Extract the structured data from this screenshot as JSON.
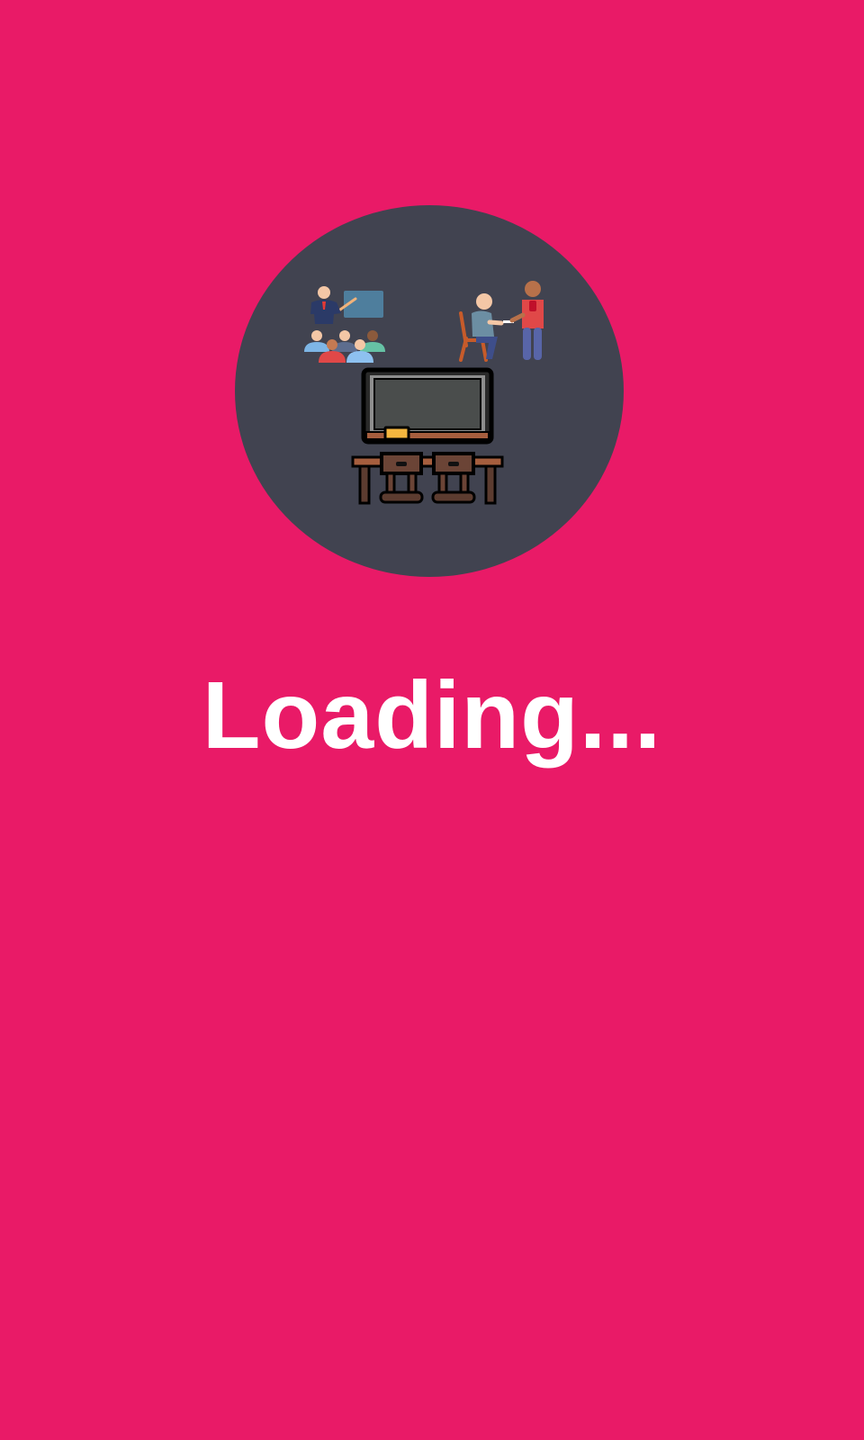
{
  "splash": {
    "loading_text": "Loading...",
    "background_color": "#E91A67",
    "logo_background_color": "#414350",
    "logo_icons": [
      "teacher-presenting-icon",
      "tutor-and-student-icon",
      "chalkboard-desk-icon"
    ]
  }
}
